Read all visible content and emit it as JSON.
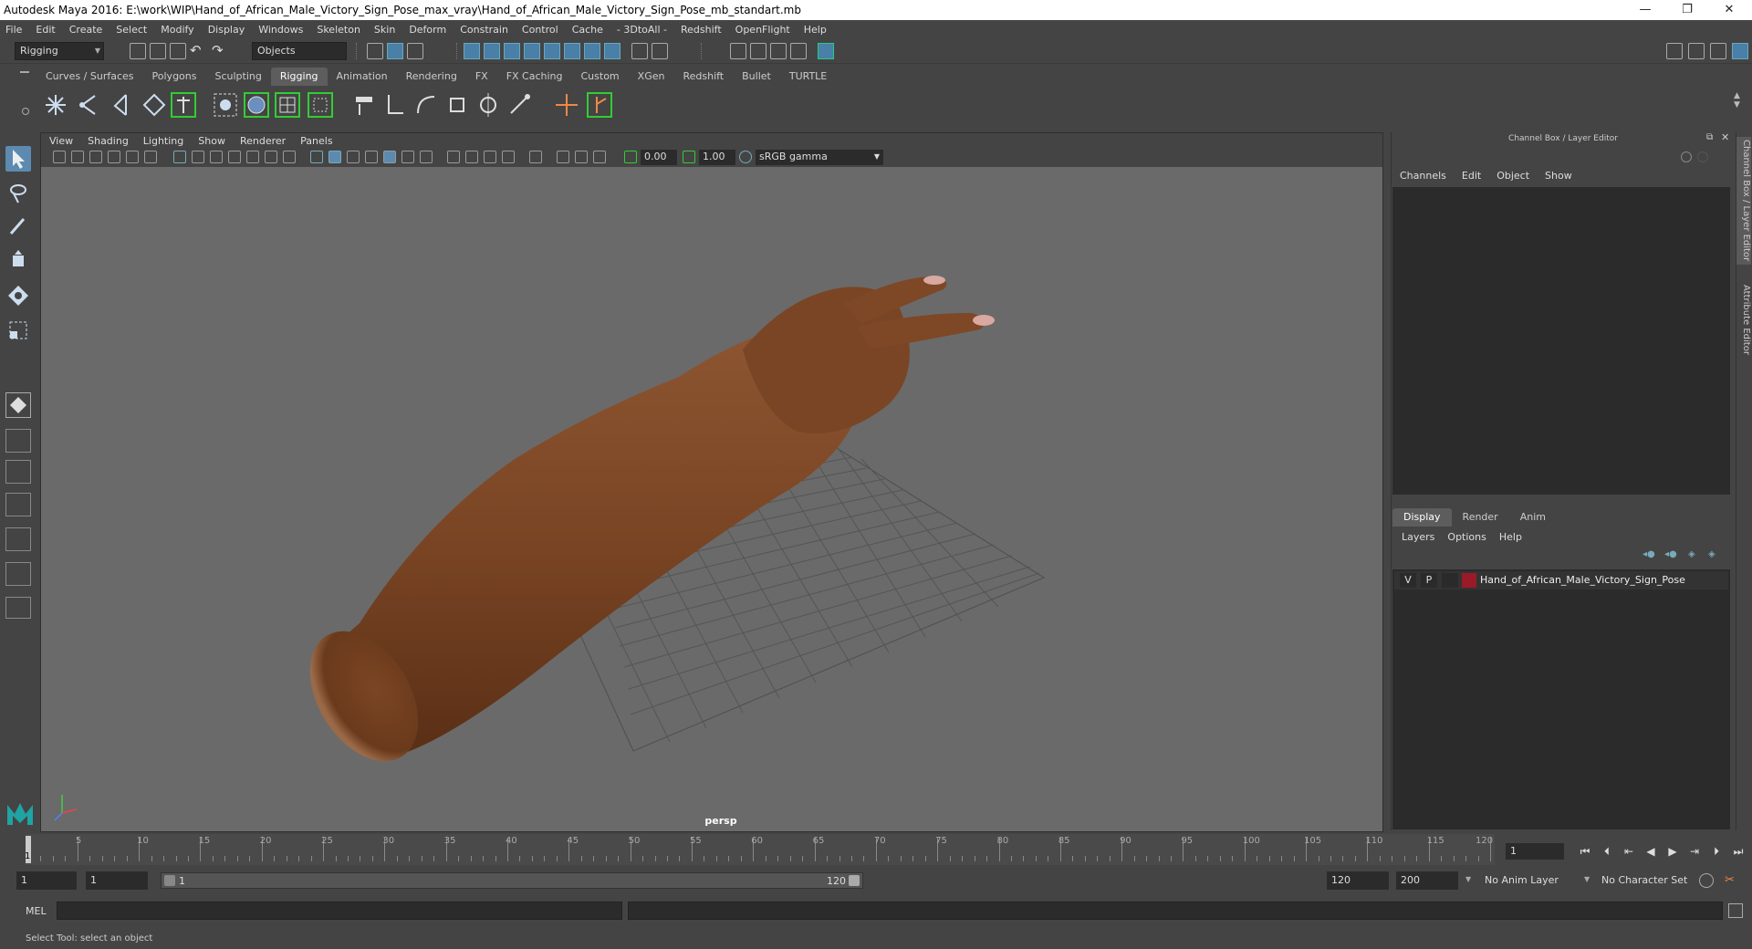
{
  "window": {
    "title": "Autodesk Maya 2016: E:\\work\\WIP\\Hand_of_African_Male_Victory_Sign_Pose_max_vray\\Hand_of_African_Male_Victory_Sign_Pose_mb_standart.mb",
    "minimize": "—",
    "restore": "❐",
    "close": "✕"
  },
  "menubar": [
    "File",
    "Edit",
    "Create",
    "Select",
    "Modify",
    "Display",
    "Windows",
    "Skeleton",
    "Skin",
    "Deform",
    "Constrain",
    "Control",
    "Cache",
    "- 3DtoAll -",
    "Redshift",
    "OpenFlight",
    "Help"
  ],
  "statusline": {
    "menuset": "Rigging",
    "selection_mode": "Objects"
  },
  "shelf": {
    "tabs": [
      "Curves / Surfaces",
      "Polygons",
      "Sculpting",
      "Rigging",
      "Animation",
      "Rendering",
      "FX",
      "FX Caching",
      "Custom",
      "XGen",
      "Redshift",
      "Bullet",
      "TURTLE"
    ],
    "active_tab": "Rigging"
  },
  "viewport": {
    "menu": [
      "View",
      "Shading",
      "Lighting",
      "Show",
      "Renderer",
      "Panels"
    ],
    "exposure": "0.00",
    "gamma": "1.00",
    "colorspace": "sRGB gamma",
    "camera_label": "persp"
  },
  "rightpanel": {
    "title": "Channel Box / Layer Editor",
    "menu": [
      "Channels",
      "Edit",
      "Object",
      "Show"
    ],
    "layer_tabs": [
      "Display",
      "Render",
      "Anim"
    ],
    "active_layer_tab": "Display",
    "layer_menu": [
      "Layers",
      "Options",
      "Help"
    ],
    "layer": {
      "visible": "V",
      "playback": "P",
      "name": "Hand_of_African_Male_Victory_Sign_Pose",
      "color": "#9b1a2a"
    },
    "side_tabs": [
      "Channel Box / Layer Editor",
      "Attribute Editor"
    ]
  },
  "timeslider": {
    "ticks": [
      "5",
      "10",
      "15",
      "20",
      "25",
      "30",
      "35",
      "40",
      "45",
      "50",
      "55",
      "60",
      "65",
      "70",
      "75",
      "80",
      "85",
      "90",
      "95",
      "100",
      "105",
      "110",
      "115",
      "120"
    ],
    "current_frame_label": "1",
    "current_frame": "1"
  },
  "range": {
    "start": "1",
    "anim_start": "1",
    "range_start": "1",
    "range_end": "120",
    "end": "120",
    "anim_end": "200",
    "anim_layer": "No Anim Layer",
    "character_set": "No Character Set"
  },
  "commandline": {
    "language": "MEL"
  },
  "helpline": "Select Tool: select an object",
  "colors": {
    "skin": "#7a4524",
    "accent": "#5c8ab0",
    "viewport_bg": "#6a6a6a"
  }
}
